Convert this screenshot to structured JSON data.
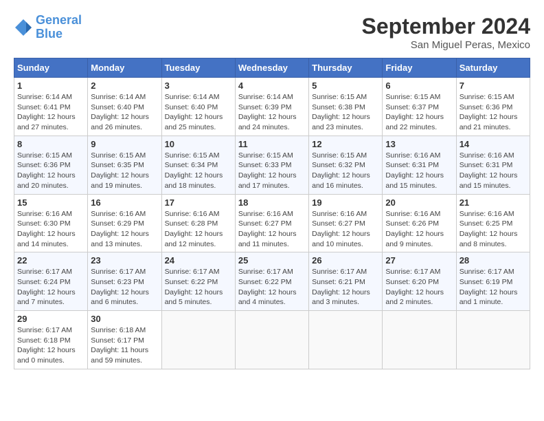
{
  "logo": {
    "line1": "General",
    "line2": "Blue"
  },
  "title": "September 2024",
  "location": "San Miguel Peras, Mexico",
  "days_of_week": [
    "Sunday",
    "Monday",
    "Tuesday",
    "Wednesday",
    "Thursday",
    "Friday",
    "Saturday"
  ],
  "weeks": [
    [
      {
        "num": "1",
        "sunrise": "6:14 AM",
        "sunset": "6:41 PM",
        "daylight": "12 hours and 27 minutes."
      },
      {
        "num": "2",
        "sunrise": "6:14 AM",
        "sunset": "6:40 PM",
        "daylight": "12 hours and 26 minutes."
      },
      {
        "num": "3",
        "sunrise": "6:14 AM",
        "sunset": "6:40 PM",
        "daylight": "12 hours and 25 minutes."
      },
      {
        "num": "4",
        "sunrise": "6:14 AM",
        "sunset": "6:39 PM",
        "daylight": "12 hours and 24 minutes."
      },
      {
        "num": "5",
        "sunrise": "6:15 AM",
        "sunset": "6:38 PM",
        "daylight": "12 hours and 23 minutes."
      },
      {
        "num": "6",
        "sunrise": "6:15 AM",
        "sunset": "6:37 PM",
        "daylight": "12 hours and 22 minutes."
      },
      {
        "num": "7",
        "sunrise": "6:15 AM",
        "sunset": "6:36 PM",
        "daylight": "12 hours and 21 minutes."
      }
    ],
    [
      {
        "num": "8",
        "sunrise": "6:15 AM",
        "sunset": "6:36 PM",
        "daylight": "12 hours and 20 minutes."
      },
      {
        "num": "9",
        "sunrise": "6:15 AM",
        "sunset": "6:35 PM",
        "daylight": "12 hours and 19 minutes."
      },
      {
        "num": "10",
        "sunrise": "6:15 AM",
        "sunset": "6:34 PM",
        "daylight": "12 hours and 18 minutes."
      },
      {
        "num": "11",
        "sunrise": "6:15 AM",
        "sunset": "6:33 PM",
        "daylight": "12 hours and 17 minutes."
      },
      {
        "num": "12",
        "sunrise": "6:15 AM",
        "sunset": "6:32 PM",
        "daylight": "12 hours and 16 minutes."
      },
      {
        "num": "13",
        "sunrise": "6:16 AM",
        "sunset": "6:31 PM",
        "daylight": "12 hours and 15 minutes."
      },
      {
        "num": "14",
        "sunrise": "6:16 AM",
        "sunset": "6:31 PM",
        "daylight": "12 hours and 15 minutes."
      }
    ],
    [
      {
        "num": "15",
        "sunrise": "6:16 AM",
        "sunset": "6:30 PM",
        "daylight": "12 hours and 14 minutes."
      },
      {
        "num": "16",
        "sunrise": "6:16 AM",
        "sunset": "6:29 PM",
        "daylight": "12 hours and 13 minutes."
      },
      {
        "num": "17",
        "sunrise": "6:16 AM",
        "sunset": "6:28 PM",
        "daylight": "12 hours and 12 minutes."
      },
      {
        "num": "18",
        "sunrise": "6:16 AM",
        "sunset": "6:27 PM",
        "daylight": "12 hours and 11 minutes."
      },
      {
        "num": "19",
        "sunrise": "6:16 AM",
        "sunset": "6:27 PM",
        "daylight": "12 hours and 10 minutes."
      },
      {
        "num": "20",
        "sunrise": "6:16 AM",
        "sunset": "6:26 PM",
        "daylight": "12 hours and 9 minutes."
      },
      {
        "num": "21",
        "sunrise": "6:16 AM",
        "sunset": "6:25 PM",
        "daylight": "12 hours and 8 minutes."
      }
    ],
    [
      {
        "num": "22",
        "sunrise": "6:17 AM",
        "sunset": "6:24 PM",
        "daylight": "12 hours and 7 minutes."
      },
      {
        "num": "23",
        "sunrise": "6:17 AM",
        "sunset": "6:23 PM",
        "daylight": "12 hours and 6 minutes."
      },
      {
        "num": "24",
        "sunrise": "6:17 AM",
        "sunset": "6:22 PM",
        "daylight": "12 hours and 5 minutes."
      },
      {
        "num": "25",
        "sunrise": "6:17 AM",
        "sunset": "6:22 PM",
        "daylight": "12 hours and 4 minutes."
      },
      {
        "num": "26",
        "sunrise": "6:17 AM",
        "sunset": "6:21 PM",
        "daylight": "12 hours and 3 minutes."
      },
      {
        "num": "27",
        "sunrise": "6:17 AM",
        "sunset": "6:20 PM",
        "daylight": "12 hours and 2 minutes."
      },
      {
        "num": "28",
        "sunrise": "6:17 AM",
        "sunset": "6:19 PM",
        "daylight": "12 hours and 1 minute."
      }
    ],
    [
      {
        "num": "29",
        "sunrise": "6:17 AM",
        "sunset": "6:18 PM",
        "daylight": "12 hours and 0 minutes."
      },
      {
        "num": "30",
        "sunrise": "6:18 AM",
        "sunset": "6:17 PM",
        "daylight": "11 hours and 59 minutes."
      },
      null,
      null,
      null,
      null,
      null
    ]
  ]
}
